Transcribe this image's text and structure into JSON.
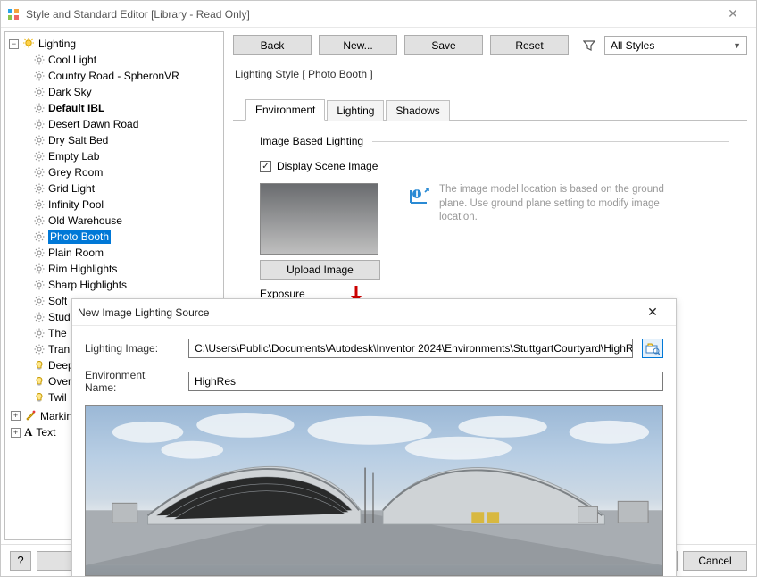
{
  "window": {
    "title": "Style and Standard Editor [Library - Read Only]"
  },
  "toolbar": {
    "back": "Back",
    "new": "New...",
    "save": "Save",
    "reset": "Reset",
    "styles_filter": "All Styles"
  },
  "breadcrumb": "Lighting Style [ Photo Booth ]",
  "tabs": {
    "environment": "Environment",
    "lighting": "Lighting",
    "shadows": "Shadows"
  },
  "env": {
    "section": "Image Based Lighting",
    "display_scene": "Display Scene Image",
    "upload": "Upload Image",
    "exposure": "Exposure",
    "info": "The image model location is based on the ground plane. Use ground plane setting to modify image location."
  },
  "tree": {
    "root": "Lighting",
    "items": [
      "Cool Light",
      "Country Road - SpheronVR",
      "Dark Sky",
      "Default IBL",
      "Desert Dawn Road",
      "Dry Salt Bed",
      "Empty Lab",
      "Grey Room",
      "Grid Light",
      "Infinity Pool",
      "Old Warehouse",
      "Photo Booth",
      "Plain Room",
      "Rim Highlights",
      "Sharp Highlights",
      "Soft",
      "Studio",
      "The",
      "Tran",
      "Deep",
      "Over",
      "Twil"
    ],
    "marking": "Marking",
    "text": "Text"
  },
  "footer": {
    "cancel": "Cancel",
    "help": "?"
  },
  "modal": {
    "title": "New Image Lighting Source",
    "lighting_image_label": "Lighting Image:",
    "lighting_image_value": "C:\\Users\\Public\\Documents\\Autodesk\\Inventor 2024\\Environments\\StuttgartCourtyard\\HighRes.hdr",
    "env_name_label": "Environment Name:",
    "env_name_value": "HighRes"
  }
}
